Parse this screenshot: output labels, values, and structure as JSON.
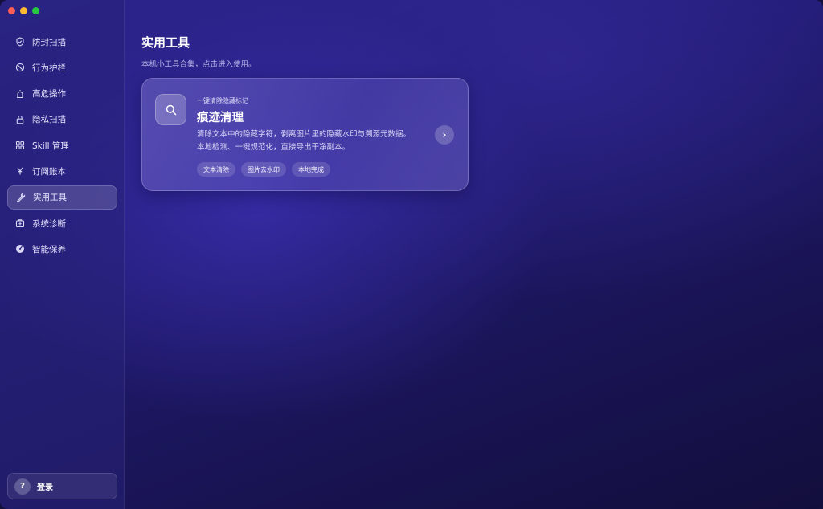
{
  "sidebar": {
    "items": [
      {
        "label": "防封扫描",
        "icon": "shield-check-icon"
      },
      {
        "label": "行为护栏",
        "icon": "prohibited-icon"
      },
      {
        "label": "高危操作",
        "icon": "alarm-light-icon"
      },
      {
        "label": "隐私扫描",
        "icon": "lock-icon"
      },
      {
        "label": "Skill 管理",
        "icon": "grid-icon"
      },
      {
        "label": "订阅账本",
        "icon": "yen-icon"
      },
      {
        "label": "实用工具",
        "icon": "wrench-icon",
        "active": true
      },
      {
        "label": "系统诊断",
        "icon": "medical-box-icon"
      },
      {
        "label": "智能保养",
        "icon": "gauge-icon"
      }
    ],
    "login": {
      "avatar": "?",
      "label": "登录"
    }
  },
  "main": {
    "title": "实用工具",
    "subtitle": "本机小工具合集，点击进入使用。",
    "card": {
      "kicker": "一键清除隐藏标记",
      "title": "痕迹清理",
      "description": "清除文本中的隐藏字符，剥离图片里的隐藏水印与溯源元数据。本地检测、一键规范化，直接导出干净副本。",
      "tags": [
        "文本清除",
        "图片去水印",
        "本地完成"
      ],
      "arrow": "›",
      "icon": "search-icon"
    }
  },
  "colors": {
    "accent": "#5a4fd1",
    "background": "#1a1558",
    "close": "#ff5f57",
    "minimize": "#febc2e",
    "zoom": "#28c840"
  }
}
